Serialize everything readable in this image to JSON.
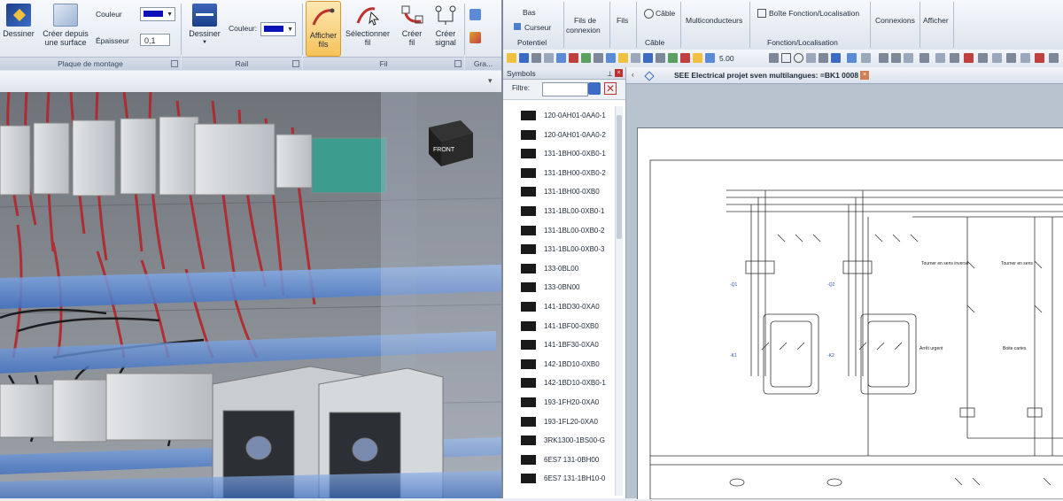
{
  "left_ribbon": {
    "dessiner_label": "Dessiner",
    "creer_surface_label_1": "Créer depuis",
    "creer_surface_label_2": "une surface",
    "couleur_label": "Couleur",
    "epaisseur_label": "Épaisseur",
    "epaisseur_value": "0,1",
    "group_plaque": "Plaque de montage",
    "rail_dessiner_label": "Dessiner",
    "rail_couleur_label": "Couleur:",
    "group_rail": "Rail",
    "afficher_fils_label_1": "Afficher",
    "afficher_fils_label_2": "fils",
    "selectionner_fil_label_1": "Sélectionner",
    "selectionner_fil_label_2": "fil",
    "creer_fil_label_1": "Créer",
    "creer_fil_label_2": "fil",
    "creer_signal_label_1": "Créer",
    "creer_signal_label_2": "signal",
    "group_fil": "Fil",
    "group_gra": "Gra...",
    "color_value": "#0a12b8"
  },
  "view3d": {
    "front_label": "FRONT"
  },
  "right_ribbon": {
    "bas_label": "Bas",
    "curseur_label": "Curseur",
    "potentiel_group": "Potentiel",
    "fils_connexion_1": "Fils de",
    "fils_connexion_2": "connexion",
    "fils_label": "Fils",
    "cable_label": "Câble",
    "cable_group": "Câble",
    "multiconducteurs_label": "Multiconducteurs",
    "boite_label": "Boîte Fonction/Localisation",
    "fonction_group": "Fonction/Localisation",
    "connexions_label": "Connexions",
    "afficher_label": "Afficher"
  },
  "toolbar": {
    "zoom_value": "5.00"
  },
  "symbols_panel": {
    "title": "Symbols",
    "filter_label": "Filtre:",
    "items": [
      "120-0AH01-0AA0-1",
      "120-0AH01-0AA0-2",
      "131-1BH00-0XB0-1",
      "131-1BH00-0XB0-2",
      "131-1BH00-0XB0",
      "131-1BL00-0XB0-1",
      "131-1BL00-0XB0-2",
      "131-1BL00-0XB0-3",
      "133-0BL00",
      "133-0BN00",
      "141-1BD30-0XA0",
      "141-1BF00-0XB0",
      "141-1BF30-0XA0",
      "142-1BD10-0XB0",
      "142-1BD10-0XB0-1",
      "193-1FH20-0XA0",
      "193-1FL20-0XA0",
      "3RK1300-1BS00-G",
      "6ES7 131-0BH00",
      "6ES7 131-1BH10-0"
    ]
  },
  "document": {
    "tab_title": "SEE Electrical projet sven multilangues: =BK1 0008",
    "label_tourner_1": "Tourner en sens inverse",
    "label_tourner_2": "Tourner en sens",
    "label_arret": "Arrêt urgent",
    "label_boite": "Boite cartes"
  }
}
